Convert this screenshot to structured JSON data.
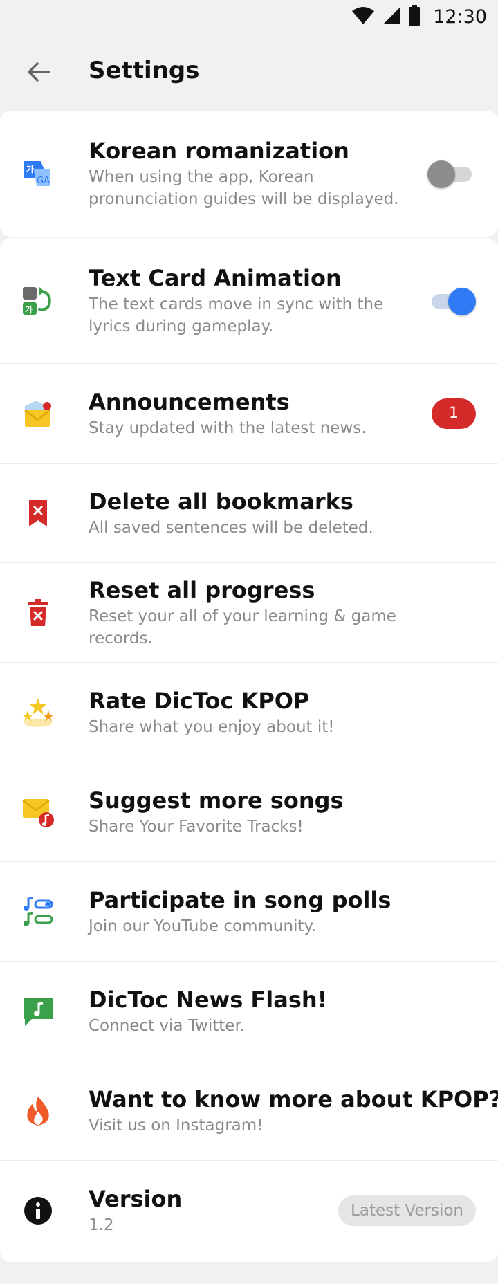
{
  "status": {
    "time": "12:30"
  },
  "header": {
    "title": "Settings"
  },
  "settings": [
    {
      "id": "romanization",
      "title": "Korean romanization",
      "subtitle_lines": [
        "When using the app, Korean",
        "pronunciation guides will be displayed."
      ],
      "control": "toggle",
      "toggle_on": false,
      "icon": "korean-romanization-icon"
    },
    {
      "id": "animation",
      "title": "Text Card Animation",
      "subtitle_lines": [
        "The text cards move in sync with the",
        "lyrics during gameplay."
      ],
      "control": "toggle",
      "toggle_on": true,
      "icon": "text-card-animation-icon"
    },
    {
      "id": "announcements",
      "title": "Announcements",
      "subtitle_lines": [
        "Stay updated with the latest news."
      ],
      "control": "badge",
      "badge": "1",
      "icon": "mail-notification-icon"
    },
    {
      "id": "bookmarks",
      "title": "Delete all bookmarks",
      "subtitle_lines": [
        "All saved sentences will be deleted."
      ],
      "icon": "bookmark-delete-icon"
    },
    {
      "id": "reset",
      "title": "Reset all progress",
      "subtitle_lines": [
        "Reset your all of your learning & game records."
      ],
      "icon": "trash-icon"
    },
    {
      "id": "rate",
      "title": "Rate DicToc KPOP",
      "subtitle_lines": [
        "Share what you enjoy about it!"
      ],
      "icon": "stars-icon"
    },
    {
      "id": "suggest",
      "title": "Suggest more songs",
      "subtitle_lines": [
        "Share Your Favorite Tracks!"
      ],
      "icon": "mail-music-icon"
    },
    {
      "id": "polls",
      "title": "Participate in song polls",
      "subtitle_lines": [
        "Join our YouTube community."
      ],
      "icon": "music-poll-icon"
    },
    {
      "id": "news",
      "title": "DicToc News Flash!",
      "subtitle_lines": [
        "Connect via Twitter."
      ],
      "icon": "chat-music-icon"
    },
    {
      "id": "kpop",
      "title": "Want to know more about KPOP?",
      "subtitle_lines": [
        "Visit us on Instagram!"
      ],
      "icon": "fire-icon"
    },
    {
      "id": "version",
      "title": "Version",
      "subtitle_lines": [
        "1.2"
      ],
      "control": "pill",
      "pill": "Latest Version",
      "icon": "info-icon"
    }
  ],
  "colors": {
    "accent": "#2f7bf5",
    "badge": "#d52a2a",
    "background": "#f1f1f1"
  }
}
